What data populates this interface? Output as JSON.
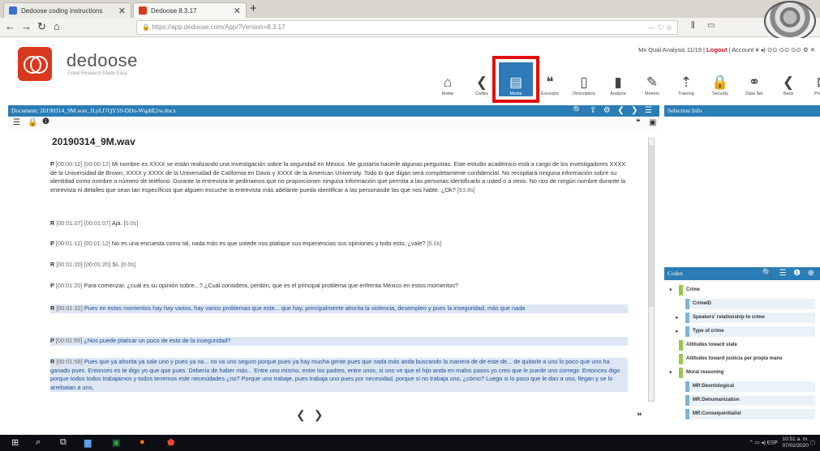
{
  "browser": {
    "tabs": [
      {
        "label": "Dedoose coding instructions"
      },
      {
        "label": "Dedoose 8.3.17"
      }
    ],
    "url": "https://app.dedoose.com/App/?Version=8.3.17",
    "url_icons": "··· ♡ ☆"
  },
  "app": {
    "logo_text": "dedoose",
    "tagline": "Great Research Made Easy",
    "user_line_pre": "Mx Qual Analysis 11/19 | ",
    "logout": "Logout",
    "user_line_post": " | Account",
    "toolbar": [
      {
        "label": "Home",
        "icon": "⌂"
      },
      {
        "label": "Codes",
        "icon": "❮"
      },
      {
        "label": "Media",
        "icon": "▤"
      },
      {
        "label": "Excerpts",
        "icon": "❝"
      },
      {
        "label": "Descriptors",
        "icon": "▯"
      },
      {
        "label": "Analyze",
        "icon": "▮"
      },
      {
        "label": "Memos",
        "icon": "✎"
      },
      {
        "label": "Training",
        "icon": "⇡"
      },
      {
        "label": "Security",
        "icon": "🔒"
      },
      {
        "label": "Data Set",
        "icon": "⚭"
      },
      {
        "label": "Back",
        "icon": "❮"
      },
      {
        "label": "Projects",
        "icon": "⊠"
      }
    ]
  },
  "document": {
    "header": "Document: 20190314_9M.wav_fLyLf7QY59-DDo-WqdtE2w.docx",
    "title": "20190314_9M.wav",
    "paragraphs": [
      {
        "tag": "P",
        "ts": "[00:00:12] [00:00:12]",
        "text": "Mi nombre es XXXX se están realizando una investigación sobre la seguridad en México. Me gustaría hacerle algunas preguntas. Este estudio académico está a cargo de los investigadores XXXX de la Universidad de Brown, XXXX y XXXX de la Universidad de California en Davis y XXXX de la American University. Todo lo que digan será completamente confidencial. No recopilará ninguna información sobre su identidad como nombre o número de teléfono. Durante la entrevista le pediríamos que no proporcionen ninguna información que permita a las personas identificarlo a usted o a otros. No nos de ningún nombre durante la entrevista ni detalles que sean tan específicos que alguien escuche la entrevista más adelante pueda identificar a las personasde las que nos hable. ¿Ok?",
        "end": "[53.8s]"
      },
      {
        "tag": "R",
        "ts": "[00:01:07] [00:01:07]",
        "text": "Ajá.",
        "end": "[0.0s]"
      },
      {
        "tag": "P",
        "ts": "[00:01:12] [00:01:12]",
        "text": "No es una encuesta como tal, nada más es que ustede nos platique sus experiencias sus opiniones y todo esto, ¿vale?",
        "end": "[5.0s]"
      },
      {
        "tag": "R",
        "ts": "[00:01:20] [00:01:20]",
        "text": "Sí.",
        "end": "[0.0s]"
      },
      {
        "tag": "P",
        "ts": "[00:01:20]",
        "text": "Para comenzar, ¿cuál es su opinión sobre...? ¿Cuál considera, perdón, que es el principal problema que enfrenta México en estos momentos?",
        "end": ""
      },
      {
        "tag": "R",
        "ts": "[00:01:32]",
        "text": "Pues en estos momentos hay hay varios, hay varios problemas que este... que hay, principalmente ahorita la violencia, desempleo y pues la inseguridad, más que nada",
        "end": ""
      },
      {
        "tag": "P",
        "ts": "[00:01:55]",
        "text": "¿Nos puede platicar un poco de esto de la inseguridad?",
        "end": ""
      },
      {
        "tag": "R",
        "ts": "[00:01:58]",
        "text": "Pues que ya ahorita ya sale uno y pues ya no... no va uno seguro porque pues ya hay mucha gente pues que nada más anda buscando la manera de de este de... de quitarle a uno lo poco que uno ha ganado pues. Entonces es te digo yo que que pues. Debería de haber más... Entre uno mismo, entre los padres, entre unos, si uno ve que el hijo anda en malos pasos yo creo que le puede uno corregir. Entonces digo porque todos todos trabajamos y todos tenemos este necesidades ¿no? Porque uno trabaje, pues trabaja uno pues por necesidad, porque si no trabaja uno, ¿cómo? Luego si lo poco que le dan a uno, llegan y se lo arrebatan a uno,",
        "end": ""
      }
    ]
  },
  "panels": {
    "selection_title": "Selection Info",
    "codes_title": "Codes",
    "codes": [
      {
        "label": "Crime",
        "level": 0,
        "caret": "▾"
      },
      {
        "label": "CrimeID",
        "level": 1,
        "caret": ""
      },
      {
        "label": "Speakers' relationship to crime",
        "level": 1,
        "caret": "▸"
      },
      {
        "label": "Type of crime",
        "level": 1,
        "caret": "▸"
      },
      {
        "label": "Attitudes toward state",
        "level": 0,
        "caret": ""
      },
      {
        "label": "Attitudes toward justicia por propia mano",
        "level": 0,
        "caret": ""
      },
      {
        "label": "Moral reasoning",
        "level": 0,
        "caret": "▾"
      },
      {
        "label": "MR:Deontological",
        "level": 1,
        "caret": ""
      },
      {
        "label": "MR:Dehumanization",
        "level": 1,
        "caret": ""
      },
      {
        "label": "MR:Consequentialist",
        "level": 1,
        "caret": ""
      }
    ]
  },
  "taskbar": {
    "time": "10:51 a. m.",
    "date": "07/02/2020",
    "lang": "ESP"
  },
  "colors": {
    "accent": "#2a7db5",
    "brand": "#d9381e",
    "highlight_box": "#e01010"
  }
}
